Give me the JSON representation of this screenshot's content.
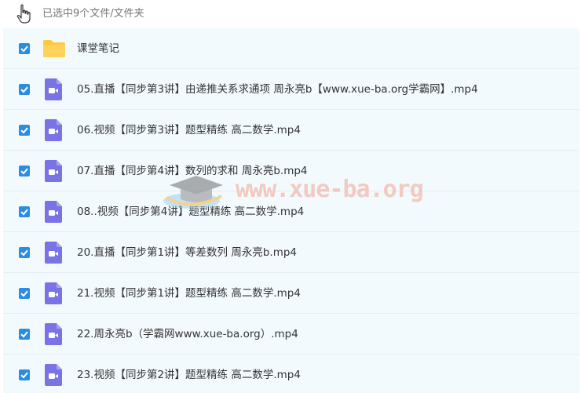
{
  "header": {
    "selection_text": "已选中9个文件/文件夹",
    "cursor_icon": "hand-pointer-icon"
  },
  "colors": {
    "checkbox": "#2b8ce0",
    "video_icon": "#7a73e6",
    "folder": "#ffc940",
    "list_background": "#f3fafe",
    "watermark_text": "#f2a48e"
  },
  "files": [
    {
      "name": "课堂笔记",
      "type": "folder",
      "checked": true
    },
    {
      "name": "05.直播【同步第3讲】由递推关系求通项 周永亮b【www.xue-ba.org学霸网】.mp4",
      "type": "video",
      "checked": true
    },
    {
      "name": "06.视频【同步第3讲】题型精练 高二数学.mp4",
      "type": "video",
      "checked": true
    },
    {
      "name": "07.直播【同步第4讲】数列的求和 周永亮b.mp4",
      "type": "video",
      "checked": true
    },
    {
      "name": "08..视频【同步第4讲】题型精练 高二数学.mp4",
      "type": "video",
      "checked": true
    },
    {
      "name": "20.直播【同步第1讲】等差数列 周永亮b.mp4",
      "type": "video",
      "checked": true
    },
    {
      "name": "21.视频【同步第1讲】题型精练 高二数学.mp4",
      "type": "video",
      "checked": true
    },
    {
      "name": "22.周永亮b（学霸网www.xue-ba.org）.mp4",
      "type": "video",
      "checked": true
    },
    {
      "name": "23.视频【同步第2讲】题型精练 高二数学.mp4",
      "type": "video",
      "checked": true
    }
  ],
  "watermark": {
    "text": "www.xue-ba.org",
    "logo_icon": "graduation-cap-icon"
  }
}
